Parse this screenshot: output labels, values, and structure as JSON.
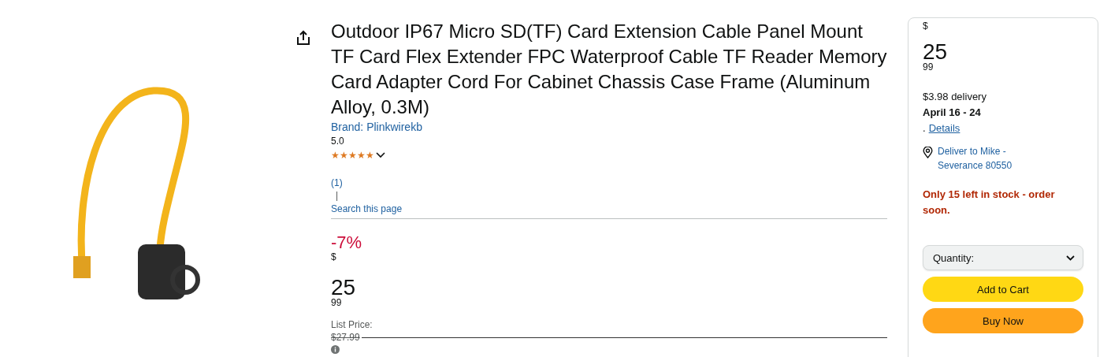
{
  "product": {
    "title": "Outdoor IP67 Micro SD(TF) Card Extension Cable Panel Mount TF Card Flex Extender FPC Waterproof Cable TF Reader Memory Card Adapter Cord For Cabinet Chassis Case Frame (Aluminum Alloy, 0.3M)",
    "brand": "Brand: Plinkwirekb",
    "rating": "5.0",
    "stars": 5,
    "review_count": "(1)",
    "separator": "|",
    "search_link": "Search this page",
    "discount": "-7%",
    "currency": "$",
    "price_whole": "25",
    "price_fraction": "99",
    "list_price_label": "List Price:",
    "list_price": "$27.99"
  },
  "buy_box": {
    "currency": "$",
    "price_whole": "25",
    "price_fraction": "99",
    "delivery": "$3.98 delivery",
    "delivery_date": "April 16 - 24",
    "details_prefix": ".",
    "details_link": "Details",
    "deliver_to": "Deliver to Mike - Severance 80550",
    "stock": "Only 15 left in stock - order soon.",
    "quantity_label": "Quantity:",
    "buttons": [
      {
        "label": "Add to Cart",
        "kind": "cart"
      },
      {
        "label": "Buy Now",
        "kind": "buy"
      }
    ]
  }
}
